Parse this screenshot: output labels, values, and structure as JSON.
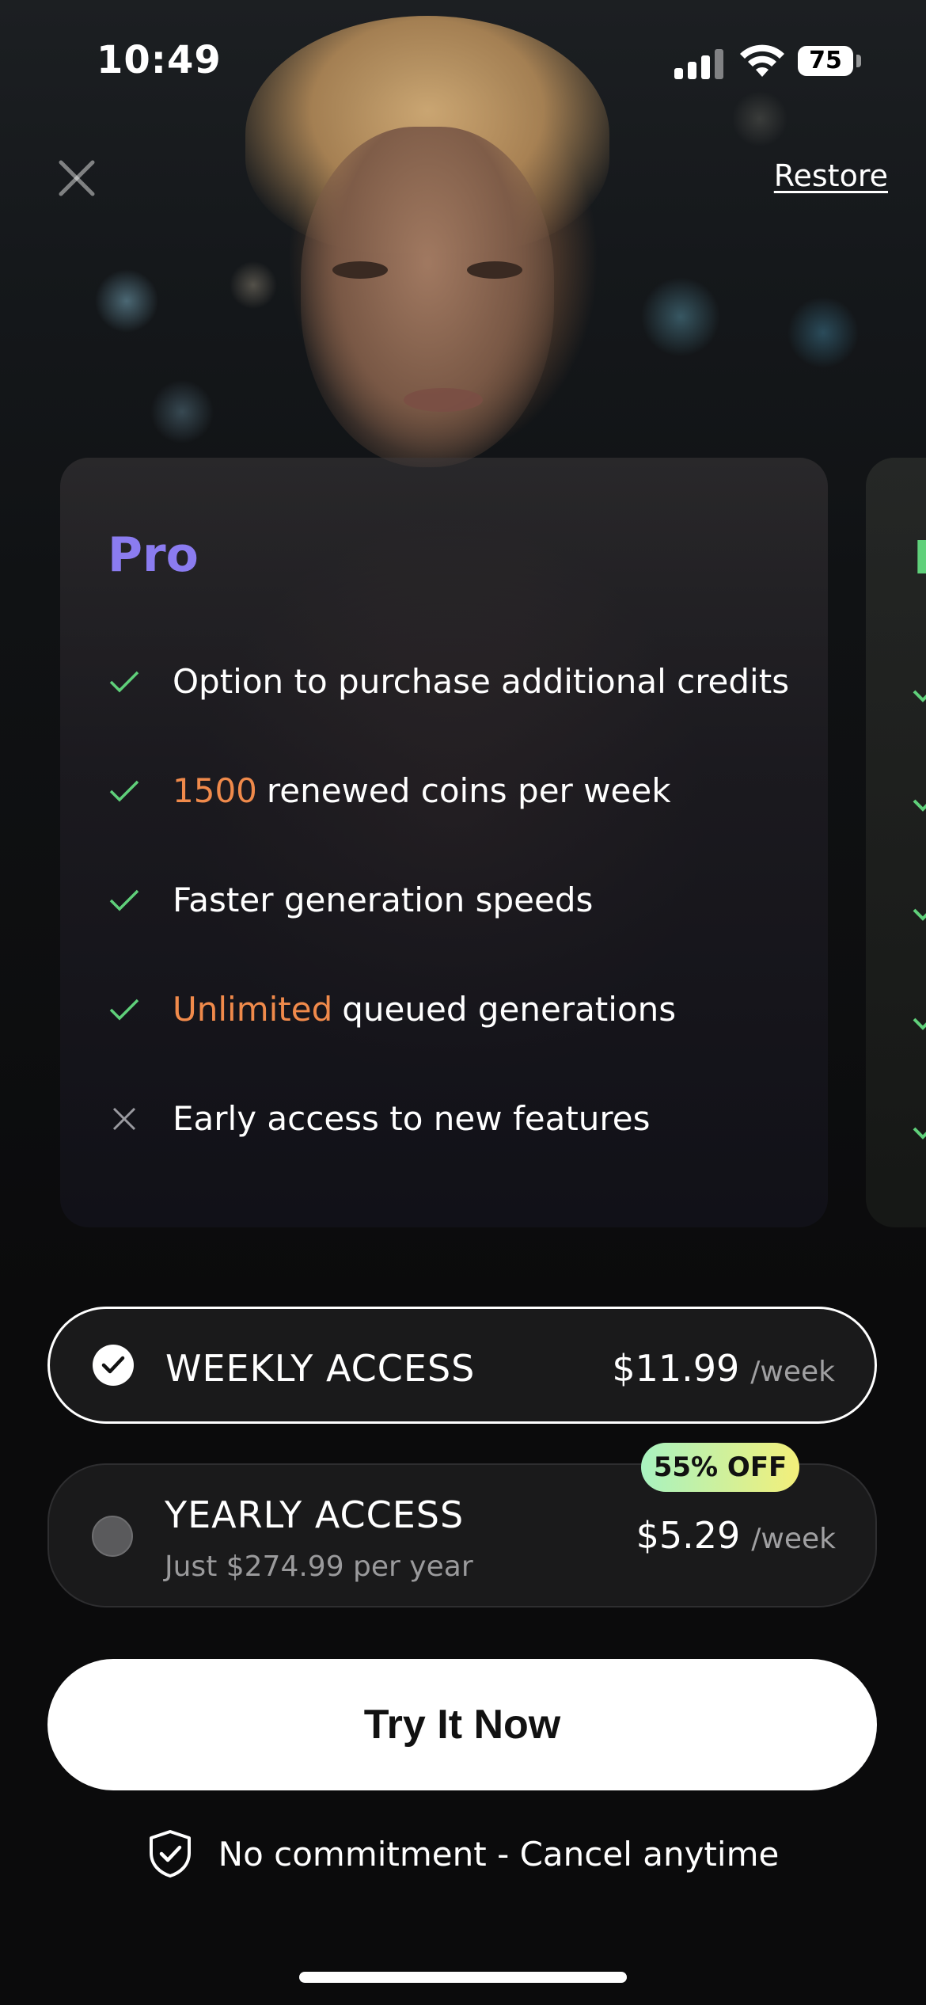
{
  "status_bar": {
    "time": "10:49",
    "battery": "75"
  },
  "header": {
    "close_icon": "close-icon",
    "restore_label": "Restore"
  },
  "plan": {
    "title": "Pro",
    "features": [
      {
        "included": true,
        "accent": "",
        "text": "Option to purchase additional credits"
      },
      {
        "included": true,
        "accent": "1500",
        "text": "renewed coins per week"
      },
      {
        "included": true,
        "accent": "",
        "text": "Faster generation speeds"
      },
      {
        "included": true,
        "accent": "Unlimited",
        "text": "queued generations"
      },
      {
        "included": false,
        "accent": "",
        "text": "Early access to new features"
      }
    ],
    "next_plan_initial": "P"
  },
  "pricing": {
    "weekly": {
      "name": "WEEKLY ACCESS",
      "price": "$11.99",
      "period": "/week",
      "selected": true
    },
    "yearly": {
      "name": "YEARLY ACCESS",
      "subtitle": "Just $274.99 per year",
      "price": "$5.29",
      "period": "/week",
      "badge": "55% OFF",
      "selected": false
    }
  },
  "cta": {
    "label": "Try It Now"
  },
  "footer": {
    "commitment": "No commitment - Cancel anytime",
    "shield_icon": "shield-check-icon"
  },
  "colors": {
    "accent_purple": "#8b7cf0",
    "accent_orange": "#f08a4b",
    "check_green": "#5fd07a",
    "badge_gradient_start": "#a8f2c0",
    "badge_gradient_end": "#f3ef7a"
  }
}
